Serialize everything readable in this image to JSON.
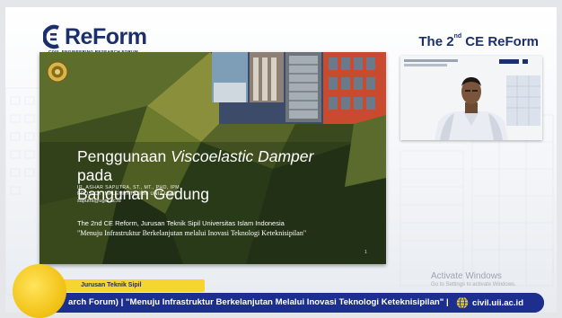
{
  "header": {
    "logo_word": "ReForm",
    "logo_sub": "CIVIL ENGINEERING RESEARCH FORUM",
    "event_title_prefix": "The 2",
    "event_title_sup": "nd",
    "event_title_suffix": " CE ReForm"
  },
  "slide": {
    "title_line1_prefix": "Penggunaan ",
    "title_line1_italic": "Viscoelastic Damper",
    "title_line1_suffix": " pada",
    "title_line2": "Bangunan Gedung",
    "author_line1": "IR. ASHAR SAPUTRA, ST., MT., PHD, IPM",
    "author_line2": "PROJECT IMPLEMENTATION UNIT UGM",
    "author_email": "saputra@ugm.ac.id",
    "footer_line1": "The 2nd CE Reform, Jurusan Teknik Sipil Universitas Islam Indonesia",
    "footer_line2": "\"Menuju Infrastruktur Berkelanjutan melalui Inovasi Teknologi Keteknisipilan\"",
    "page_number": "1"
  },
  "windows_watermark": {
    "line1": "Activate Windows",
    "line2": "Go to Settings to activate Windows."
  },
  "lower_third": {
    "tag": "Jurusan Teknik Sipil",
    "ticker": "arch Forum) | \"Menuju Infrastruktur Berkelanjutan Melalui Inovasi Teknologi Keteknisipilan\" | Jur",
    "website": "civil.uii.ac.id"
  },
  "colors": {
    "brand_navy": "#1b2f6b",
    "bar_blue": "#1c2f8f",
    "accent_yellow": "#f7d530"
  }
}
